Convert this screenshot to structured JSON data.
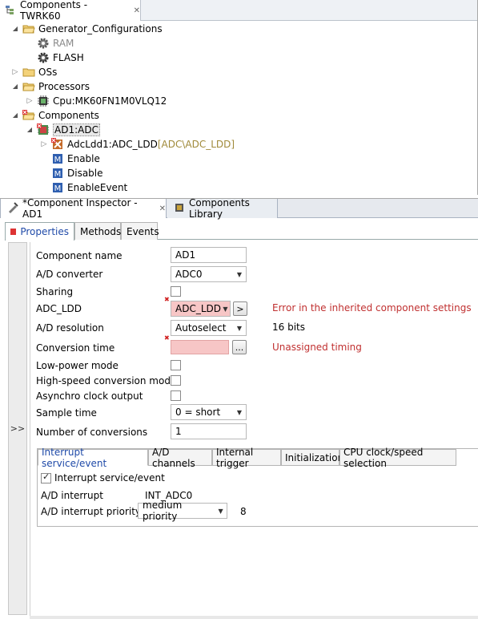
{
  "top_view": {
    "tab_title": "Components - TWRK60",
    "tree": [
      {
        "label": "Generator_Configurations",
        "level": 1,
        "state": "open",
        "icon": "folder-open-icon"
      },
      {
        "label": "RAM",
        "level": 2,
        "state": "none",
        "icon": "gear-icon",
        "gray": true
      },
      {
        "label": "FLASH",
        "level": 2,
        "state": "none",
        "icon": "gear-icon"
      },
      {
        "label": "OSs",
        "level": 1,
        "state": "closed",
        "icon": "folder-icon"
      },
      {
        "label": "Processors",
        "level": 1,
        "state": "open",
        "icon": "folder-open-icon"
      },
      {
        "label": "Cpu:MK60FN1M0VLQ12",
        "level": 2,
        "state": "closed",
        "icon": "cpu-icon"
      },
      {
        "label": "Components",
        "level": 1,
        "state": "open",
        "icon": "folder-error-icon"
      },
      {
        "label": "AD1:ADC",
        "level": 2,
        "state": "open",
        "icon": "component-error-icon",
        "selected": true
      },
      {
        "label": "AdcLdd1:ADC_LDD",
        "suffix": "[ADC\\ADC_LDD]",
        "level": 3,
        "state": "closed",
        "icon": "component-error-icon"
      },
      {
        "label": "Enable",
        "level": 3,
        "state": "none",
        "icon": "method-icon"
      },
      {
        "label": "Disable",
        "level": 3,
        "state": "none",
        "icon": "method-icon"
      },
      {
        "label": "EnableEvent",
        "level": 3,
        "state": "none",
        "icon": "method-icon"
      }
    ]
  },
  "bottom_view": {
    "tabs": [
      {
        "label": "*Component Inspector - AD1"
      },
      {
        "label": "Components Library"
      }
    ],
    "subtabs": [
      "Properties",
      "Methods",
      "Events"
    ],
    "left_strip_label": ">>",
    "props": {
      "component_name": {
        "label": "Component name",
        "value": "AD1"
      },
      "ad_converter": {
        "label": "A/D converter",
        "value": "ADC0"
      },
      "sharing": {
        "label": "Sharing"
      },
      "adc_ldd": {
        "label": "ADC_LDD",
        "value": "ADC_LDD",
        "button": ">",
        "error": "Error in the inherited component settings"
      },
      "ad_resolution": {
        "label": "A/D resolution",
        "value": "Autoselect",
        "info": "16 bits"
      },
      "conversion_time": {
        "label": "Conversion time",
        "button": "...",
        "error": "Unassigned timing"
      },
      "low_power": {
        "label": "Low-power mode"
      },
      "high_speed": {
        "label": "High-speed conversion mode"
      },
      "async_clock": {
        "label": "Asynchro clock output"
      },
      "sample_time": {
        "label": "Sample time",
        "value": "0 = short"
      },
      "num_conversions": {
        "label": "Number of conversions",
        "value": "1"
      }
    },
    "inner_tabs": [
      "Interrupt service/event",
      "A/D channels",
      "Internal trigger",
      "Initialization",
      "CPU clock/speed selection"
    ],
    "interrupt": {
      "checkbox_label": "Interrupt service/event",
      "ad_interrupt_label": "A/D interrupt",
      "ad_interrupt_value": "INT_ADC0",
      "priority_label": "A/D interrupt priority",
      "priority_value": "medium priority",
      "priority_number": "8"
    }
  }
}
